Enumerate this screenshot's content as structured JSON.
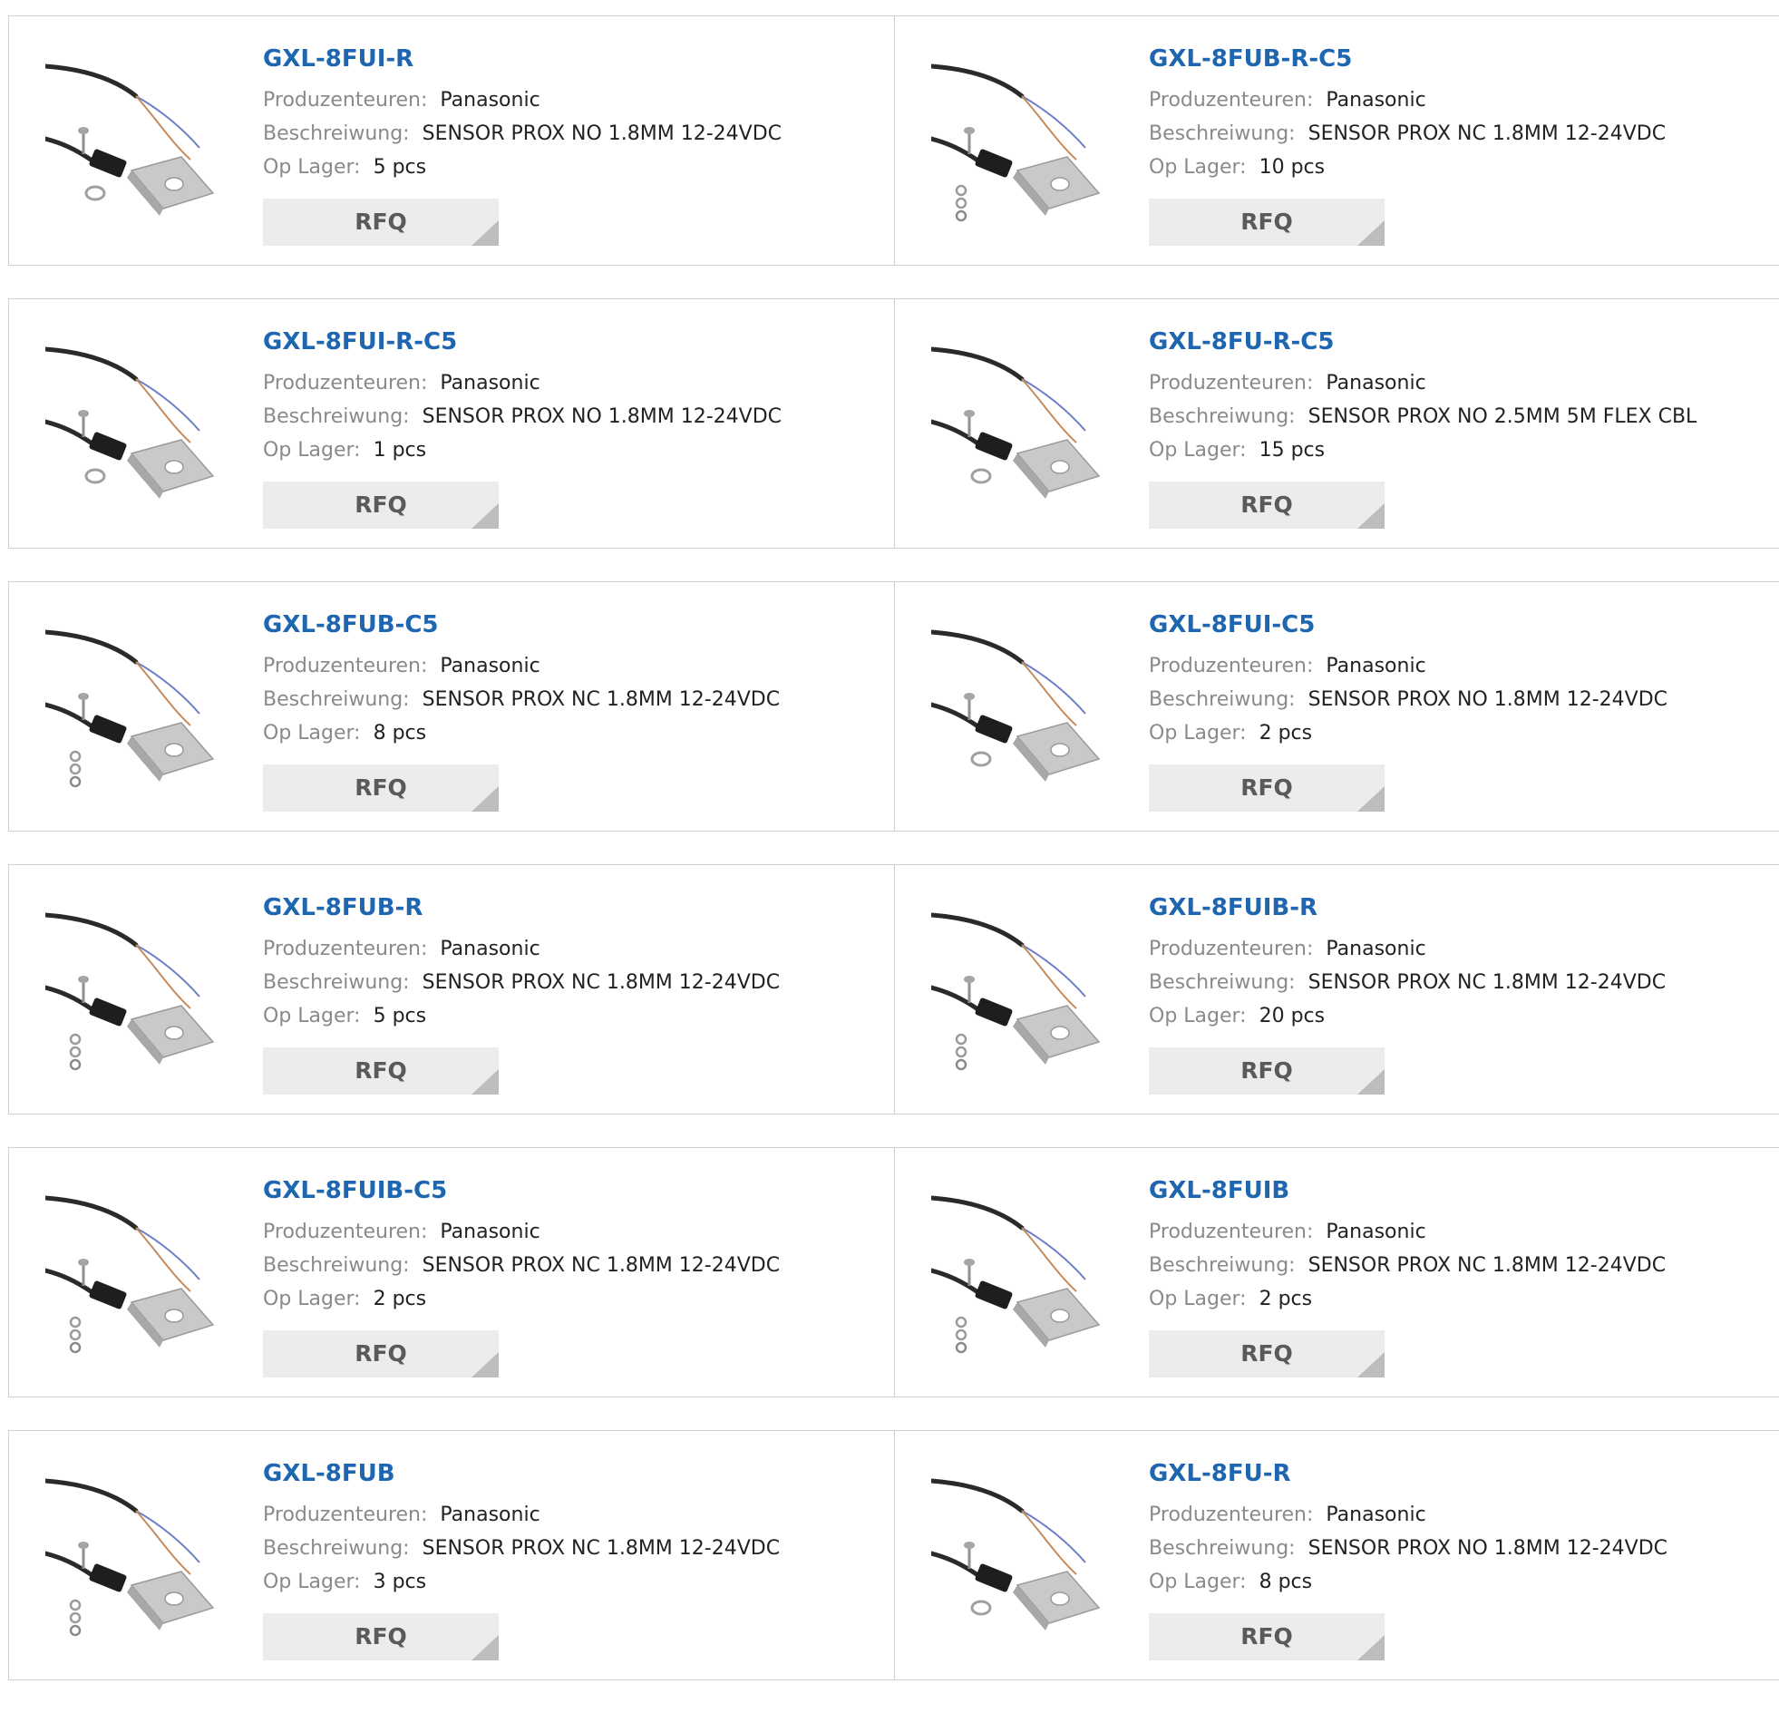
{
  "labels": {
    "manufacturer": "Produzenteuren:",
    "description": "Beschreiwung:",
    "stock": "Op Lager:",
    "rfq": "RFQ"
  },
  "colors": {
    "part_link": "#1e66b0",
    "label": "#8a8a8a",
    "value": "#222222",
    "button_bg": "#ececec"
  },
  "products": [
    {
      "part": "GXL-8FUI-R",
      "manufacturer": "Panasonic",
      "description": "SENSOR PROX NO 1.8MM 12-24VDC",
      "stock": "5 pcs",
      "image": "sensor-nut-icon"
    },
    {
      "part": "GXL-8FUB-R-C5",
      "manufacturer": "Panasonic",
      "description": "SENSOR PROX NC 1.8MM 12-24VDC",
      "stock": "10 pcs",
      "image": "sensor-nuts-icon"
    },
    {
      "part": "GXL-8FUI-R-C5",
      "manufacturer": "Panasonic",
      "description": "SENSOR PROX NO 1.8MM 12-24VDC",
      "stock": "1 pcs",
      "image": "sensor-nut-icon"
    },
    {
      "part": "GXL-8FU-R-C5",
      "manufacturer": "Panasonic",
      "description": "SENSOR PROX NO 2.5MM 5M FLEX CBL",
      "stock": "15 pcs",
      "image": "sensor-nut-icon"
    },
    {
      "part": "GXL-8FUB-C5",
      "manufacturer": "Panasonic",
      "description": "SENSOR PROX NC 1.8MM 12-24VDC",
      "stock": "8 pcs",
      "image": "sensor-nuts-icon"
    },
    {
      "part": "GXL-8FUI-C5",
      "manufacturer": "Panasonic",
      "description": "SENSOR PROX NO 1.8MM 12-24VDC",
      "stock": "2 pcs",
      "image": "sensor-nut-icon"
    },
    {
      "part": "GXL-8FUB-R",
      "manufacturer": "Panasonic",
      "description": "SENSOR PROX NC 1.8MM 12-24VDC",
      "stock": "5 pcs",
      "image": "sensor-nuts-icon"
    },
    {
      "part": "GXL-8FUIB-R",
      "manufacturer": "Panasonic",
      "description": "SENSOR PROX NC 1.8MM 12-24VDC",
      "stock": "20 pcs",
      "image": "sensor-nuts-icon"
    },
    {
      "part": "GXL-8FUIB-C5",
      "manufacturer": "Panasonic",
      "description": "SENSOR PROX NC 1.8MM 12-24VDC",
      "stock": "2 pcs",
      "image": "sensor-nuts-icon"
    },
    {
      "part": "GXL-8FUIB",
      "manufacturer": "Panasonic",
      "description": "SENSOR PROX NC 1.8MM 12-24VDC",
      "stock": "2 pcs",
      "image": "sensor-nuts-icon"
    },
    {
      "part": "GXL-8FUB",
      "manufacturer": "Panasonic",
      "description": "SENSOR PROX NC 1.8MM 12-24VDC",
      "stock": "3 pcs",
      "image": "sensor-nuts-icon"
    },
    {
      "part": "GXL-8FU-R",
      "manufacturer": "Panasonic",
      "description": "SENSOR PROX NO 1.8MM 12-24VDC",
      "stock": "8 pcs",
      "image": "sensor-nut-icon"
    }
  ]
}
